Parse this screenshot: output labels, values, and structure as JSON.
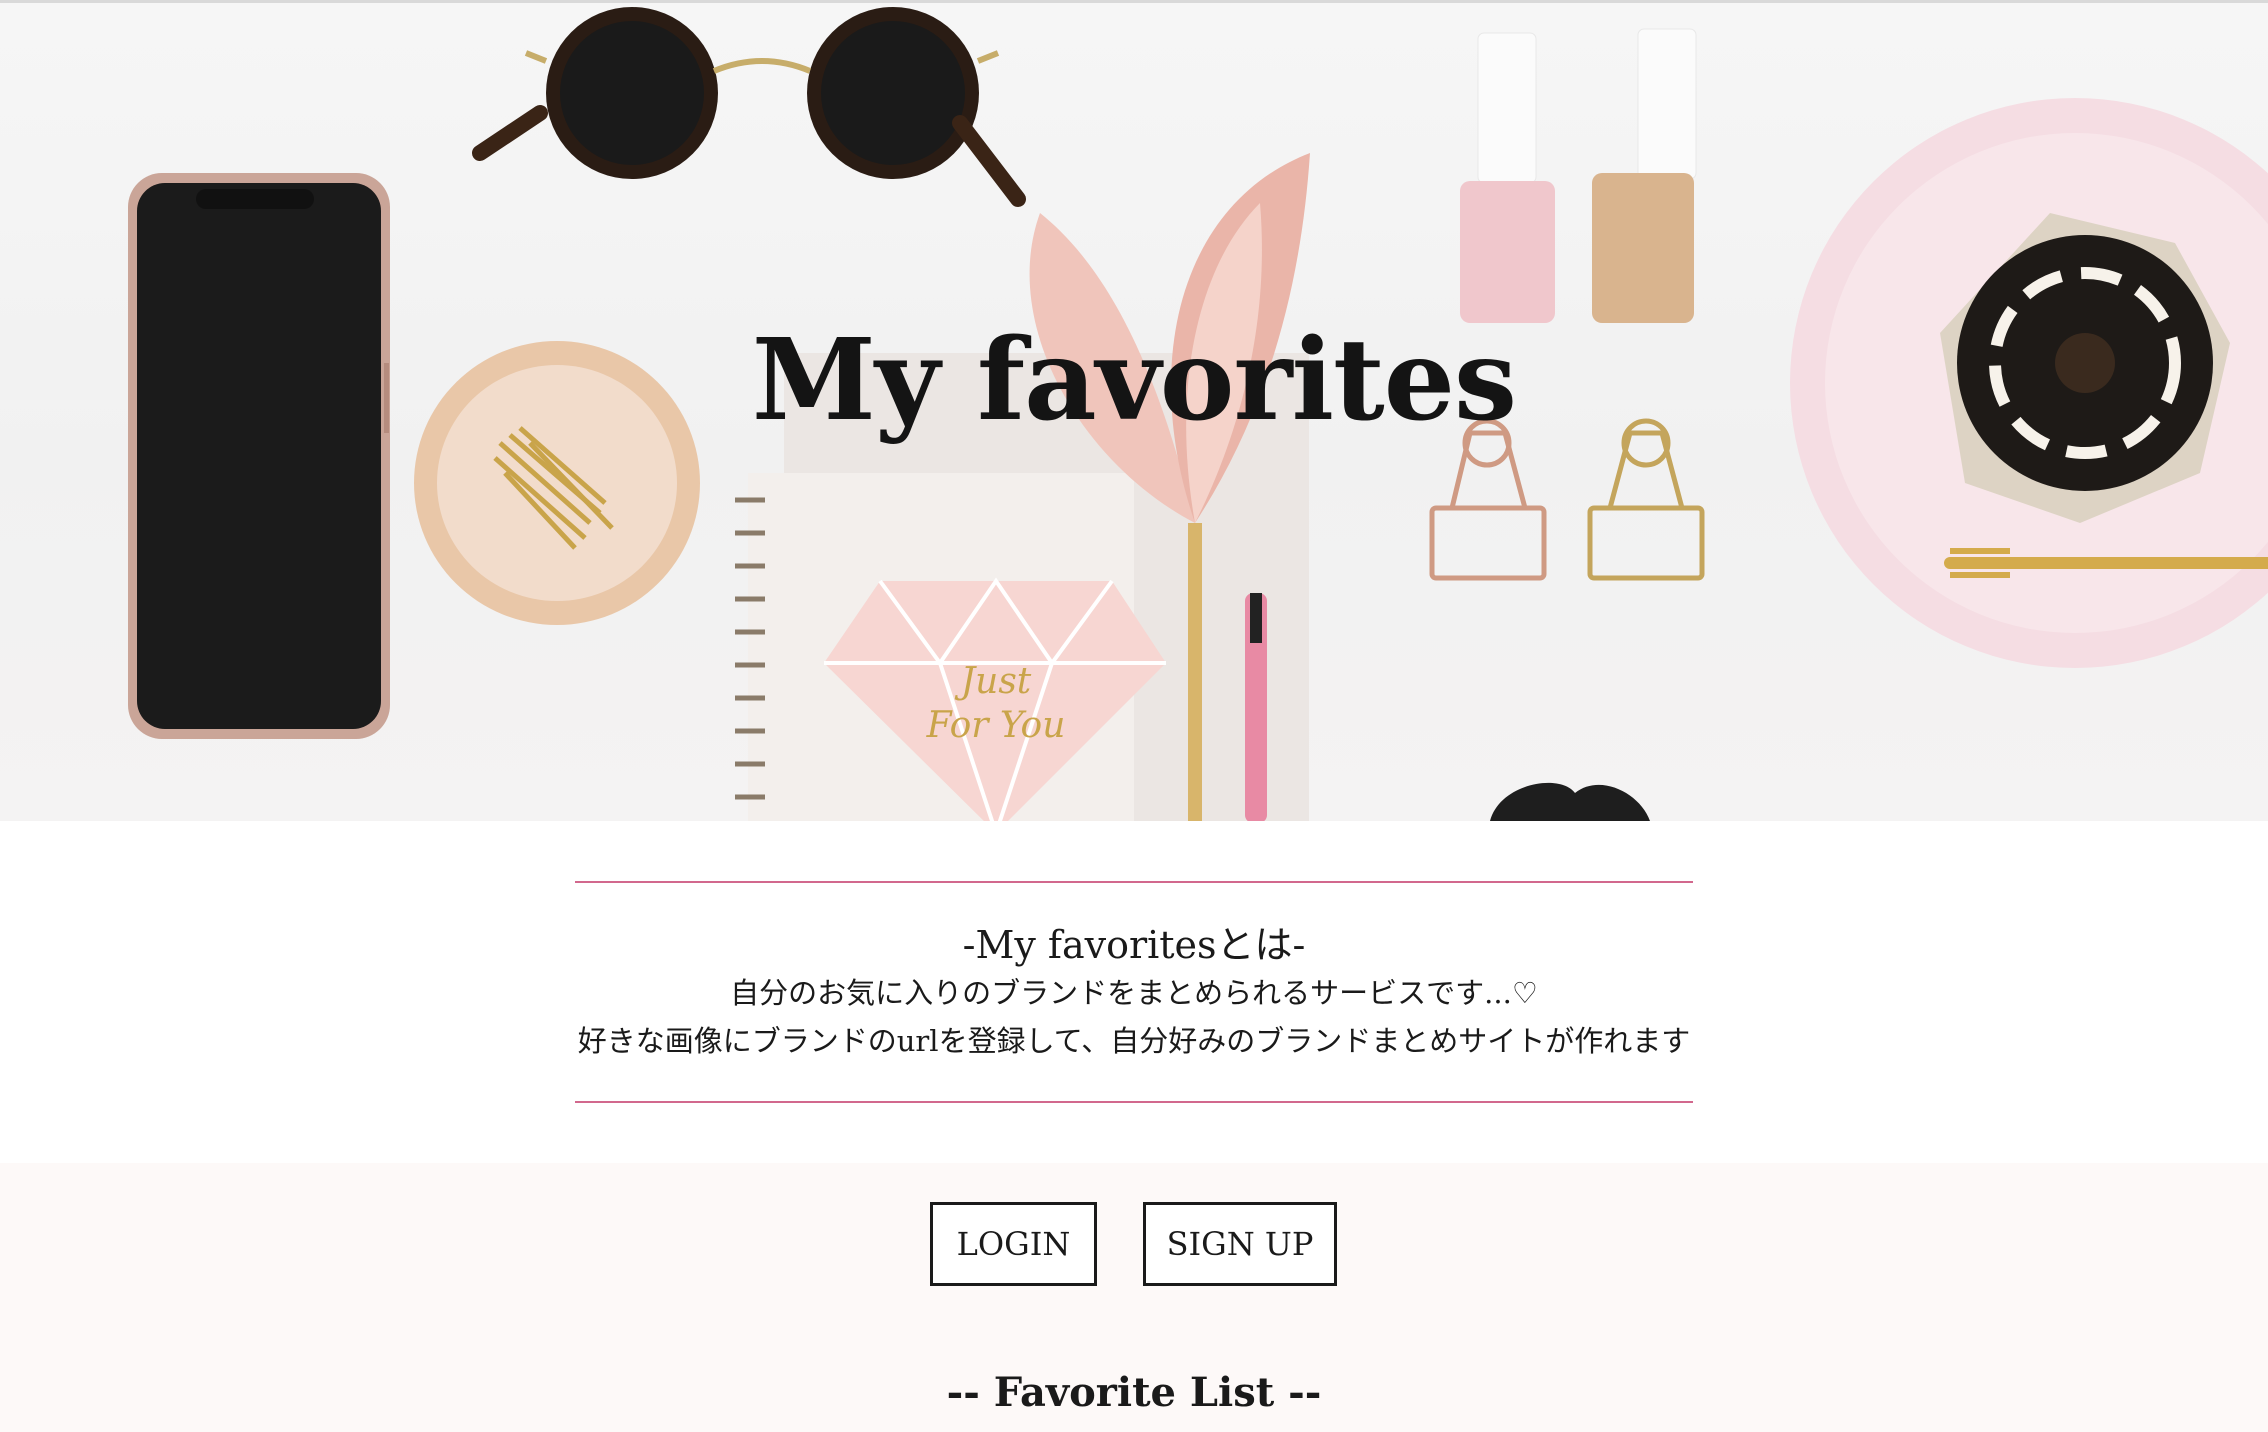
{
  "hero": {
    "title": "My favorites",
    "card_text_1": "Just",
    "card_text_2": "For You"
  },
  "intro": {
    "heading": "-My favoritesとは-",
    "line1": "自分のお気に入りのブランドをまとめられるサービスです...♡",
    "line2": "好きな画像にブランドのurlを登録して、自分好みのブランドまとめサイトが作れます"
  },
  "actions": {
    "login_label": "LOGIN",
    "signup_label": "SIGN UP"
  },
  "favorite_list": {
    "title": "-- Favorite List --"
  },
  "colors": {
    "accent_rule": "#d2688d",
    "section_bg": "#fdf9f8",
    "text": "#1a1a1a"
  }
}
